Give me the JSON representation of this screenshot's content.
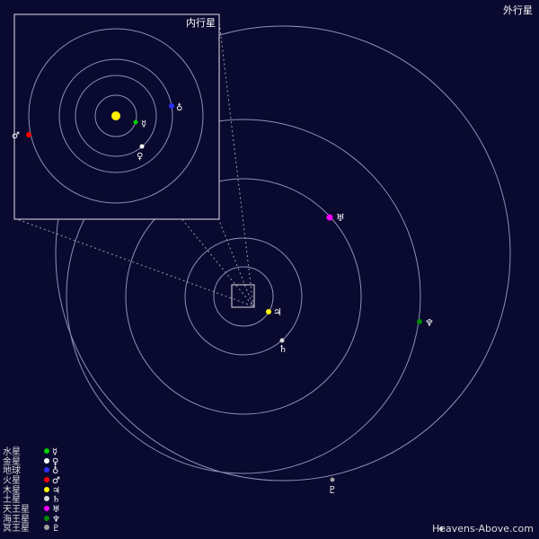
{
  "titles": {
    "inset": "内行星",
    "main": "外行星"
  },
  "watermark": {
    "icon": "♦",
    "text": "Heavens-Above.com"
  },
  "colors": {
    "background": "#0a0a30",
    "sun": "#ffee00"
  },
  "planets": [
    {
      "id": "mercury",
      "name": "水星",
      "symbol": "☿",
      "color": "#00cc00"
    },
    {
      "id": "venus",
      "name": "金星",
      "symbol": "♀",
      "color": "#ffffff"
    },
    {
      "id": "earth",
      "name": "地球",
      "symbol": "♁",
      "color": "#2f2fff"
    },
    {
      "id": "mars",
      "name": "火星",
      "symbol": "♂",
      "color": "#ff0000"
    },
    {
      "id": "jupiter",
      "name": "木星",
      "symbol": "♃",
      "color": "#ffff00"
    },
    {
      "id": "saturn",
      "name": "土星",
      "symbol": "♄",
      "color": "#d9d9d9"
    },
    {
      "id": "uranus",
      "name": "天王星",
      "symbol": "♅",
      "color": "#ff00ff"
    },
    {
      "id": "neptune",
      "name": "海王星",
      "symbol": "♆",
      "color": "#008800"
    },
    {
      "id": "pluto",
      "name": "冥王星",
      "symbol": "♇",
      "color": "#9f9f9f"
    }
  ]
}
